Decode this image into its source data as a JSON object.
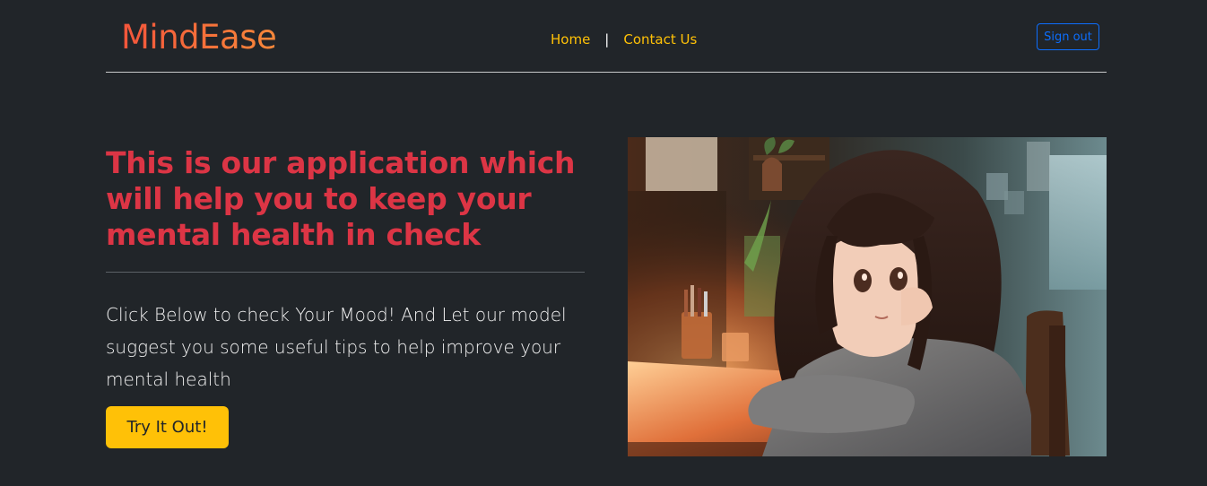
{
  "header": {
    "brand": "MindEase",
    "nav": {
      "home_label": "Home",
      "separator": "|",
      "contact_label": "Contact Us"
    },
    "signout_label": "Sign out"
  },
  "hero": {
    "headline": "This is our application which will help you to keep your mental health in check",
    "lead": "Click Below to check Your Mood! And Let our model suggest you some useful tips to help improve your mental health",
    "cta_label": "Try It Out!",
    "image_subject": "anime girl leaning on a desk in a warm sunlit room"
  },
  "colors": {
    "background": "#212529",
    "brand_gradient_start": "#f4553b",
    "brand_gradient_end": "#f7883a",
    "nav_link": "#ffc107",
    "headline": "#dc3545",
    "button_bg": "#ffc107",
    "signout": "#0d6efd"
  }
}
